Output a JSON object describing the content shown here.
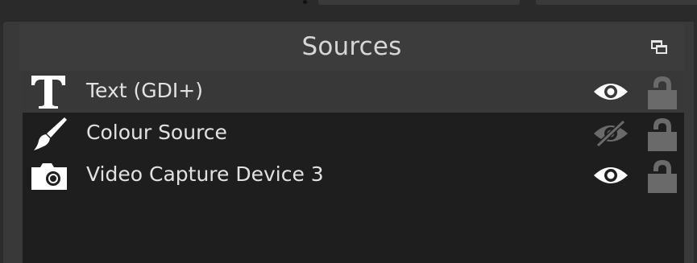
{
  "dock": {
    "title": "Sources",
    "undock_icon": "float-window-icon"
  },
  "sources": [
    {
      "label": "Text (GDI+)",
      "type_icon": "text-icon",
      "visible": true,
      "locked": false,
      "selected": true
    },
    {
      "label": "Colour Source",
      "type_icon": "paintbrush-icon",
      "visible": false,
      "locked": false,
      "selected": false
    },
    {
      "label": "Video Capture Device 3",
      "type_icon": "camera-icon",
      "visible": true,
      "locked": false,
      "selected": false
    }
  ],
  "colors": {
    "panel_bg": "#393939",
    "list_bg": "#1e1e1e",
    "selected_row": "#383838",
    "text": "#e2e2e2",
    "icon_active": "#ffffff",
    "icon_inactive": "#6a6a6a"
  }
}
